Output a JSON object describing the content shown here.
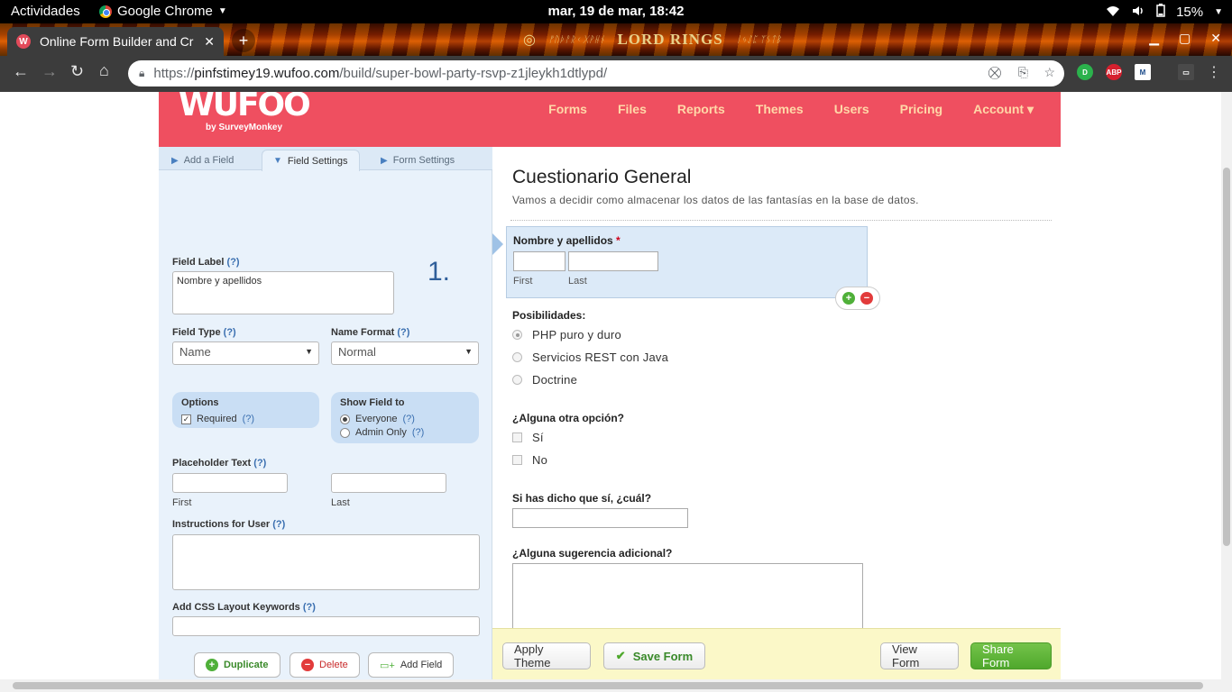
{
  "system": {
    "activities": "Actividades",
    "app_name": "Google Chrome",
    "clock": "mar, 19 de mar, 18:42",
    "battery": "15%"
  },
  "browser": {
    "tab_title": "Online Form Builder and Cr",
    "url_prefix": "https://",
    "url_host": "pinfstimey19.wufoo.com",
    "url_path": "/build/super-bowl-party-rsvp-z1jleykh1dtlypd/",
    "theme_title": "LORD RINGS",
    "theme_elvish_left": "ᚠᚢᚦᚨᚱᚲ ᚷᚹᚺᚾ",
    "theme_elvish_right": "ᛁᛃᛇᛈ ᛉᛊᛏᛒ"
  },
  "wufoo": {
    "logo": "WUFOO",
    "logo_sub": "by SurveyMonkey",
    "nav": [
      "Forms",
      "Files",
      "Reports",
      "Themes",
      "Users",
      "Pricing",
      "Account ▾"
    ]
  },
  "panel": {
    "tabs": [
      "Add a Field",
      "Field Settings",
      "Form Settings"
    ],
    "step": "1.",
    "field_label": "Field Label",
    "help": "(?)",
    "field_label_value": "Nombre y apellidos",
    "field_type": "Field Type",
    "field_type_value": "Name",
    "name_format": "Name Format",
    "name_format_value": "Normal",
    "options_title": "Options",
    "required": "Required",
    "show_title": "Show Field to",
    "everyone": "Everyone",
    "admin_only": "Admin Only",
    "placeholder_text": "Placeholder Text",
    "first": "First",
    "last": "Last",
    "instructions": "Instructions for User",
    "css_keywords": "Add CSS Layout Keywords",
    "btn_duplicate": "Duplicate",
    "btn_delete": "Delete",
    "btn_add_field": "Add Field"
  },
  "form": {
    "title": "Cuestionario General",
    "description": "Vamos a decidir como almacenar los datos de las fantasías en la base de datos.",
    "name_label": "Nombre y apellidos",
    "required_mark": "*",
    "first": "First",
    "last": "Last",
    "q1_label": "Posibilidades:",
    "q1_options": [
      "PHP puro y duro",
      "Servicios REST con Java",
      "Doctrine"
    ],
    "q2_label": "¿Alguna otra opción?",
    "q2_options": [
      "Sí",
      "No"
    ],
    "q3_label": "Si has dicho que sí, ¿cuál?",
    "q4_label": "¿Alguna sugerencia adicional?"
  },
  "bottom": {
    "apply_theme": "Apply Theme",
    "save_form": "Save Form",
    "view_form": "View Form",
    "share_form": "Share Form"
  },
  "colors": {
    "brand": "#ef4f60",
    "panel": "#e9f2fb",
    "save_green": "#4fa82c"
  }
}
